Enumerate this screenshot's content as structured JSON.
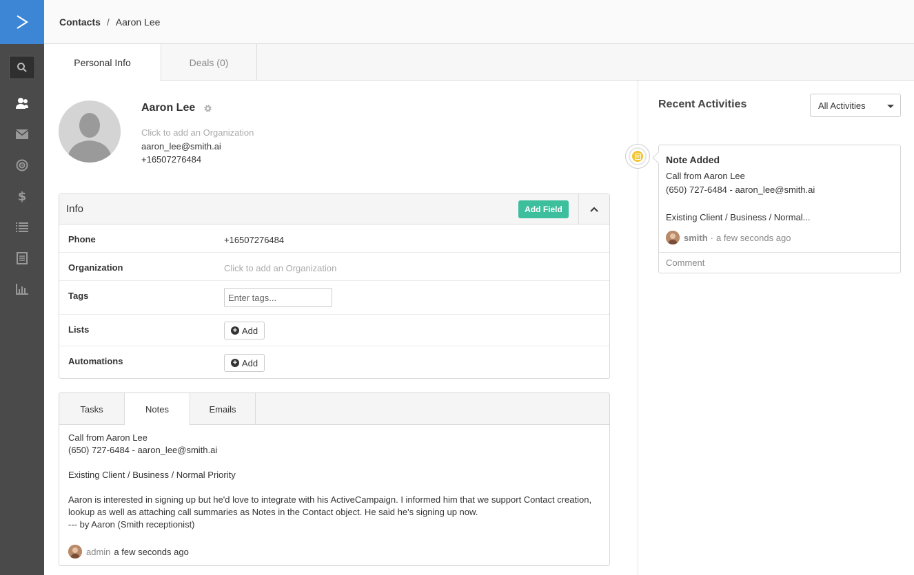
{
  "breadcrumb": {
    "root": "Contacts",
    "separator": "/",
    "current": "Aaron Lee"
  },
  "tabs": [
    {
      "label": "Personal Info",
      "active": true
    },
    {
      "label": "Deals (0)",
      "active": false
    }
  ],
  "sidebar": {
    "icons": [
      "logo-icon",
      "search-icon",
      "contacts-icon",
      "mail-icon",
      "target-icon",
      "dollar-icon",
      "list-icon",
      "document-icon",
      "reports-icon"
    ],
    "accent": "#3d86d6",
    "background": "#4a4a4a"
  },
  "profile": {
    "name": "Aaron Lee",
    "organization_placeholder": "Click to add an Organization",
    "email": "aaron_lee@smith.ai",
    "phone": "+16507276484"
  },
  "info": {
    "title": "Info",
    "add_field_label": "Add Field",
    "add_field_color": "#3dbf9e",
    "rows": [
      {
        "label": "Phone",
        "value": "+16507276484"
      },
      {
        "label": "Organization",
        "value": "Click to add an Organization"
      },
      {
        "label": "Tags",
        "placeholder": "Enter tags..."
      },
      {
        "label": "Lists",
        "button": "Add"
      },
      {
        "label": "Automations",
        "button": "Add"
      }
    ]
  },
  "notes": {
    "tabs": [
      {
        "label": "Tasks",
        "active": false
      },
      {
        "label": "Notes",
        "active": true
      },
      {
        "label": "Emails",
        "active": false
      }
    ],
    "lines": {
      "l1": "Call from Aaron Lee",
      "l2": "(650) 727-6484 - aaron_lee@smith.ai",
      "l3": "Existing Client / Business / Normal Priority",
      "l4": "Aaron is interested in signing up but he'd love to integrate with his ActiveCampaign. I informed him that we support Contact creation, lookup as well as attaching call summaries as Notes in the Contact object. He said he's signing up now.",
      "l5": "--- by Aaron (Smith receptionist)"
    },
    "author": "admin",
    "time": "a few seconds ago"
  },
  "activities": {
    "title": "Recent Activities",
    "filter": "All Activities",
    "card": {
      "title": "Note Added",
      "line1": "Call from Aaron Lee",
      "line2": "(650) 727-6484 - aaron_lee@smith.ai",
      "line3": "Existing Client / Business / Normal...",
      "user": "smith",
      "separator": "·",
      "time": "a few seconds ago",
      "comment": "Comment",
      "note_color": "#f2c532"
    }
  }
}
